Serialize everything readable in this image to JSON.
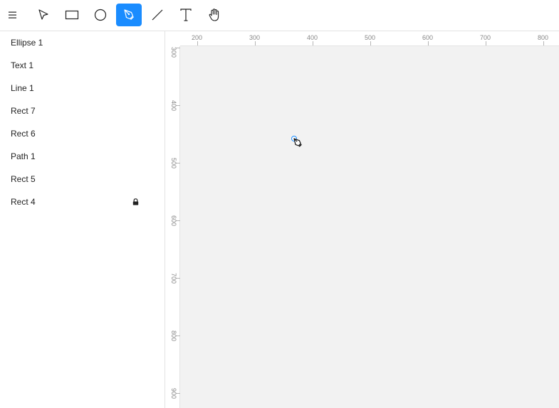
{
  "toolbar": {
    "tools": [
      {
        "name": "menu-icon",
        "active": false
      },
      {
        "name": "select-arrow-icon",
        "active": false
      },
      {
        "name": "rectangle-icon",
        "active": false
      },
      {
        "name": "ellipse-icon",
        "active": false
      },
      {
        "name": "pen-icon",
        "active": true
      },
      {
        "name": "line-icon",
        "active": false
      },
      {
        "name": "text-icon",
        "active": false
      },
      {
        "name": "hand-icon",
        "active": false
      }
    ],
    "accent_color": "#1a8cff"
  },
  "layers": [
    {
      "label": "Ellipse 1",
      "locked": false
    },
    {
      "label": "Text 1",
      "locked": false
    },
    {
      "label": "Line 1",
      "locked": false
    },
    {
      "label": "Rect 7",
      "locked": false
    },
    {
      "label": "Rect 6",
      "locked": false
    },
    {
      "label": "Path 1",
      "locked": false
    },
    {
      "label": "Rect 5",
      "locked": false
    },
    {
      "label": "Rect 4",
      "locked": true
    }
  ],
  "rulers": {
    "x_labels": [
      "200",
      "300",
      "400",
      "500",
      "600",
      "700",
      "800"
    ],
    "y_labels": [
      "300",
      "400",
      "500",
      "600",
      "700",
      "800",
      "900"
    ]
  },
  "canvas": {
    "background": "#f2f2f2"
  }
}
